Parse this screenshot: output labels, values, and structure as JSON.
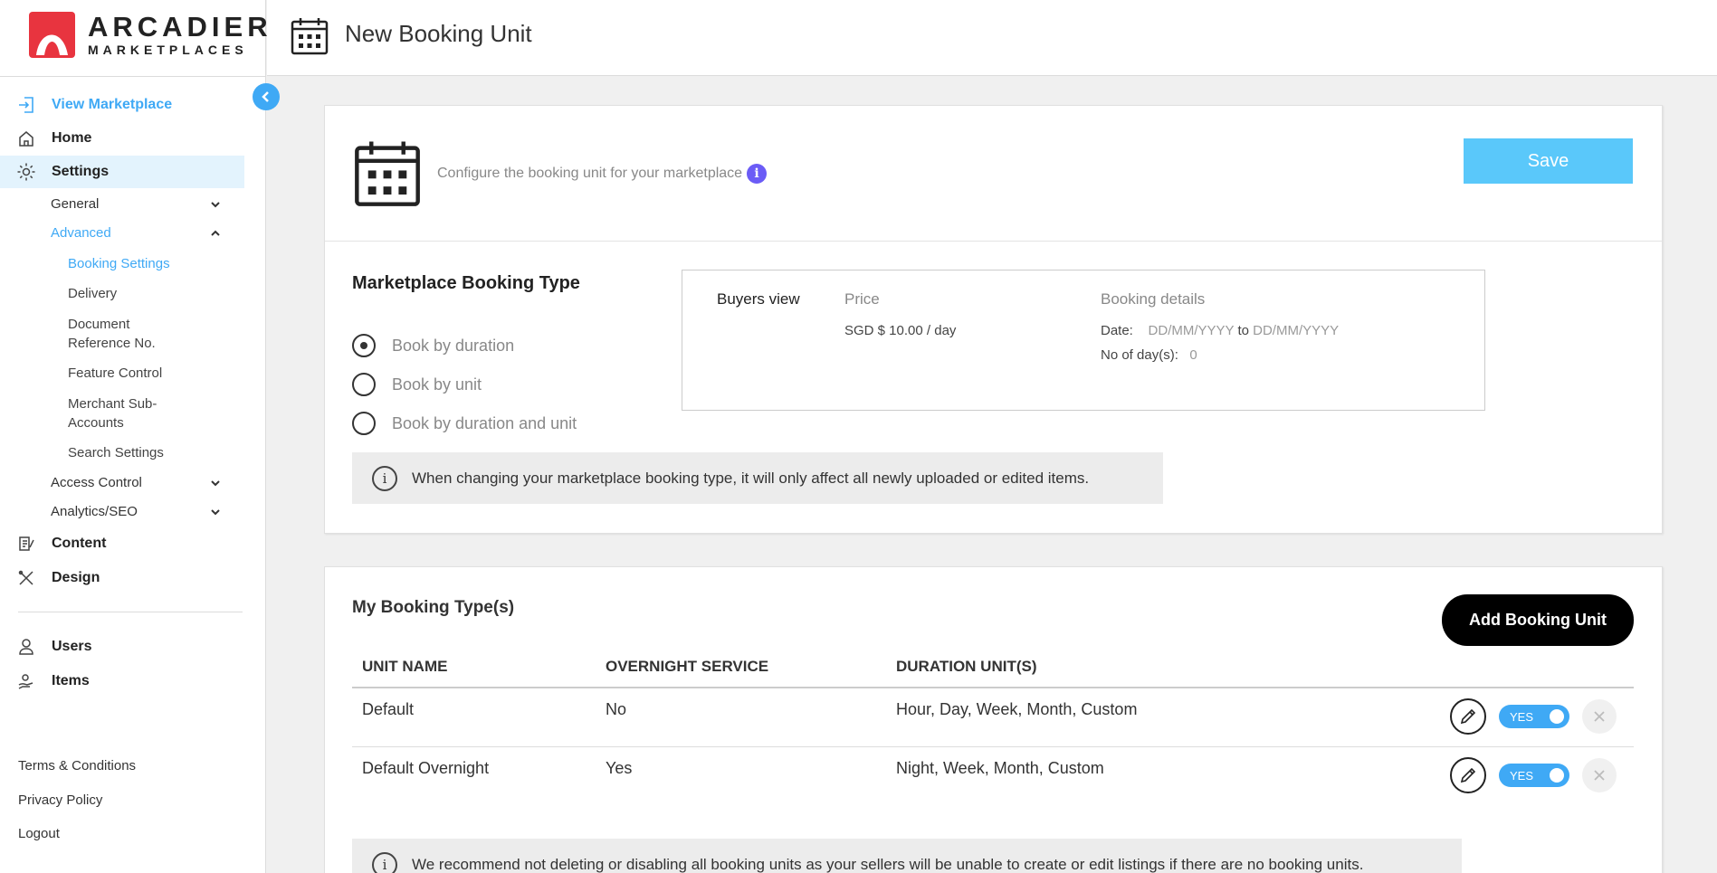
{
  "brand": {
    "title": "ARCADIER",
    "subtitle": "MARKETPLACES",
    "accent": "#e8343f"
  },
  "sidebar": {
    "top_items": [
      {
        "label": "View Marketplace",
        "icon": "enter-icon"
      },
      {
        "label": "Home",
        "icon": "home-icon"
      },
      {
        "label": "Settings",
        "icon": "gear-icon"
      }
    ],
    "settings_sub": [
      {
        "label": "General"
      },
      {
        "label": "Advanced"
      }
    ],
    "advanced_sub": [
      "Booking Settings",
      "Delivery",
      "Document Reference No.",
      "Feature Control",
      "Merchant Sub-Accounts",
      "Search Settings"
    ],
    "settings_sub2": [
      {
        "label": "Access Control"
      },
      {
        "label": "Analytics/SEO"
      }
    ],
    "bottom_items": [
      {
        "label": "Content",
        "icon": "content-icon"
      },
      {
        "label": "Design",
        "icon": "design-icon"
      }
    ],
    "user_items": [
      {
        "label": "Users",
        "icon": "user-icon"
      },
      {
        "label": "Items",
        "icon": "items-icon"
      }
    ],
    "footer": [
      "Terms & Conditions",
      "Privacy Policy",
      "Logout"
    ]
  },
  "header": {
    "title": "New Booking Unit",
    "icon": "calendar-icon"
  },
  "config": {
    "description": "Configure the booking unit for your marketplace",
    "info_glyph": "i",
    "save_label": "Save"
  },
  "booking_type": {
    "title": "Marketplace Booking Type",
    "options": [
      "Book by duration",
      "Book by unit",
      "Book by duration and unit"
    ],
    "selected": "Book by duration"
  },
  "buyers_view": {
    "label": "Buyers view",
    "price_header": "Price",
    "price_value": "SGD $ 10.00 / day",
    "details_header": "Booking details",
    "date_label": "Date:",
    "date_from": "DD/MM/YYYY",
    "date_to_word": "to",
    "date_to": "DD/MM/YYYY",
    "days_label": "No of day(s):",
    "days_value": "0"
  },
  "notes": {
    "type_change": "When changing your marketplace booking type, it will only affect all newly uploaded or edited items.",
    "recommend": "We recommend not deleting or disabling all booking units as your sellers will be unable to create or edit listings if there are no booking units."
  },
  "my_types": {
    "title": "My Booking Type(s)",
    "add_label": "Add Booking Unit",
    "columns": [
      "UNIT NAME",
      "OVERNIGHT SERVICE",
      "DURATION UNIT(S)"
    ],
    "rows": [
      {
        "name": "Default",
        "overnight": "No",
        "units": "Hour, Day, Week, Month, Custom",
        "toggle": "YES"
      },
      {
        "name": "Default Overnight",
        "overnight": "Yes",
        "units": "Night, Week, Month, Custom",
        "toggle": "YES"
      }
    ]
  },
  "colors": {
    "accent": "#3fa9f5",
    "save": "#5ac8fa",
    "info": "#6b5cf6"
  }
}
